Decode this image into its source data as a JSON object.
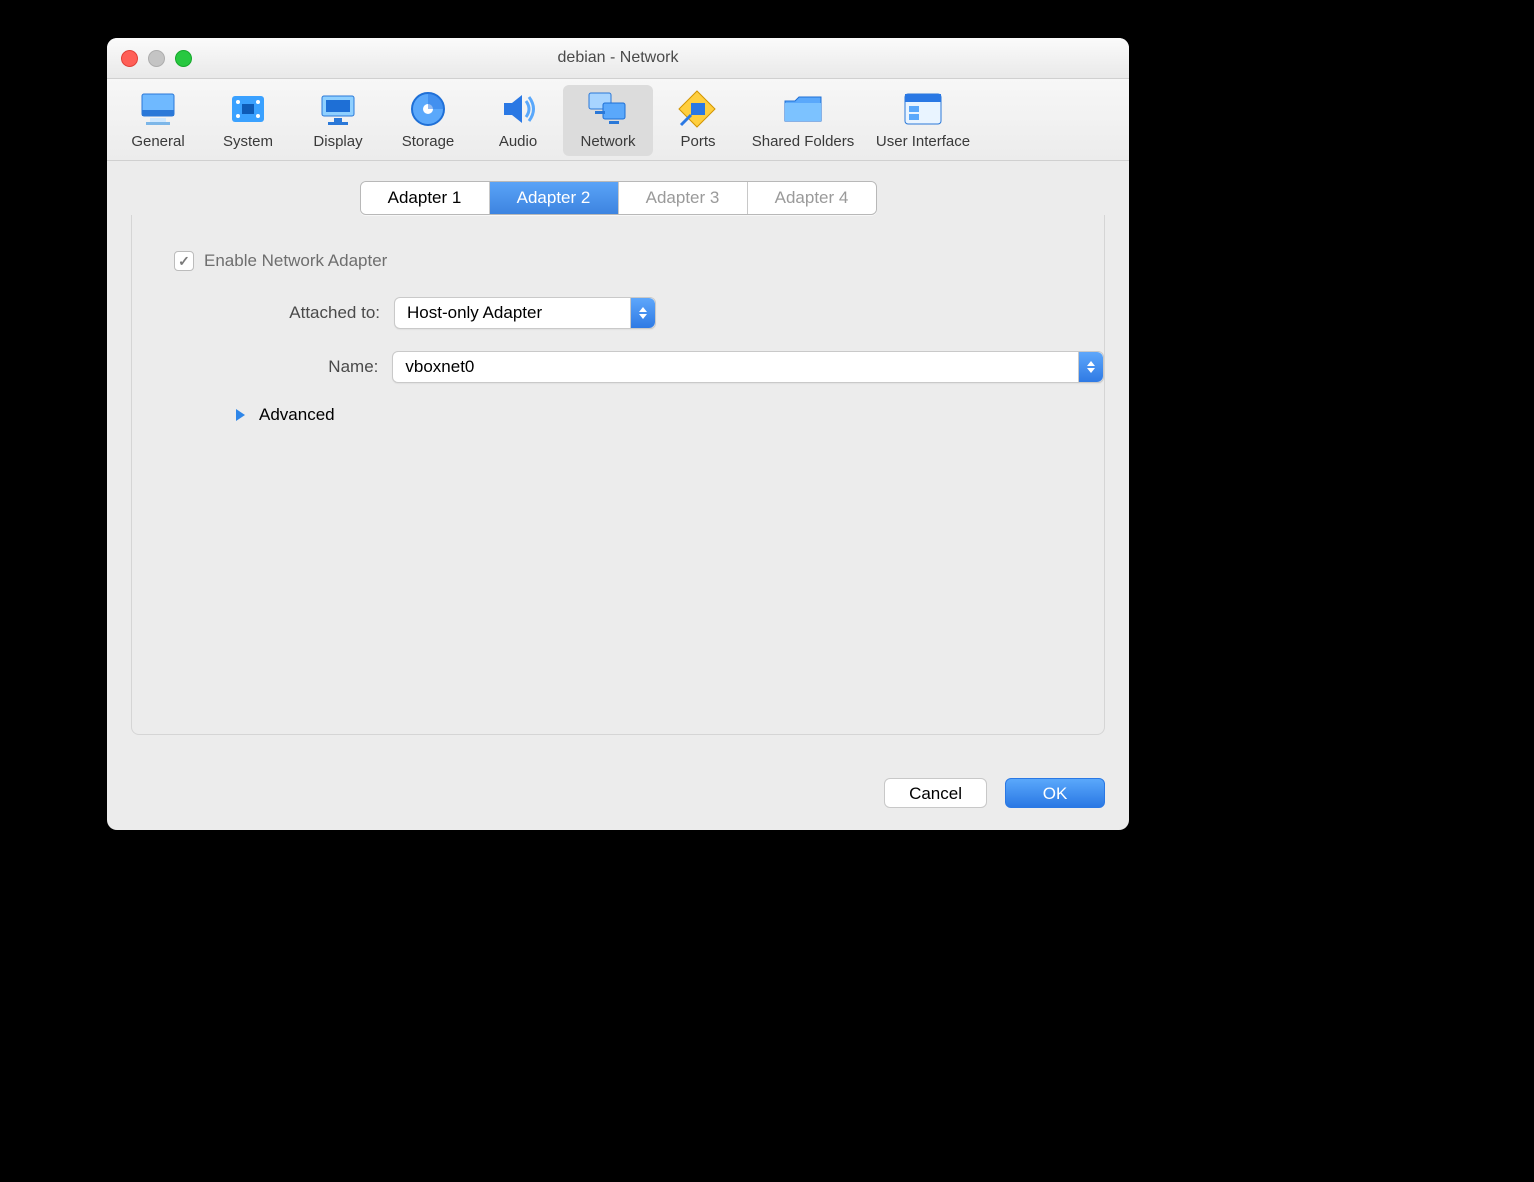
{
  "window": {
    "title": "debian - Network"
  },
  "toolbar": {
    "items": [
      {
        "label": "General"
      },
      {
        "label": "System"
      },
      {
        "label": "Display"
      },
      {
        "label": "Storage"
      },
      {
        "label": "Audio"
      },
      {
        "label": "Network"
      },
      {
        "label": "Ports"
      },
      {
        "label": "Shared Folders"
      },
      {
        "label": "User Interface"
      }
    ],
    "selected": "Network"
  },
  "tabs": {
    "items": [
      {
        "label": "Adapter 1"
      },
      {
        "label": "Adapter 2"
      },
      {
        "label": "Adapter 3"
      },
      {
        "label": "Adapter 4"
      }
    ],
    "active_index": 1
  },
  "form": {
    "enable_checkbox_label": "Enable Network Adapter",
    "enable_checked": true,
    "attached_to_label": "Attached to:",
    "attached_to_value": "Host-only Adapter",
    "name_label": "Name:",
    "name_value": "vboxnet0",
    "advanced_label": "Advanced"
  },
  "buttons": {
    "cancel": "Cancel",
    "ok": "OK"
  }
}
